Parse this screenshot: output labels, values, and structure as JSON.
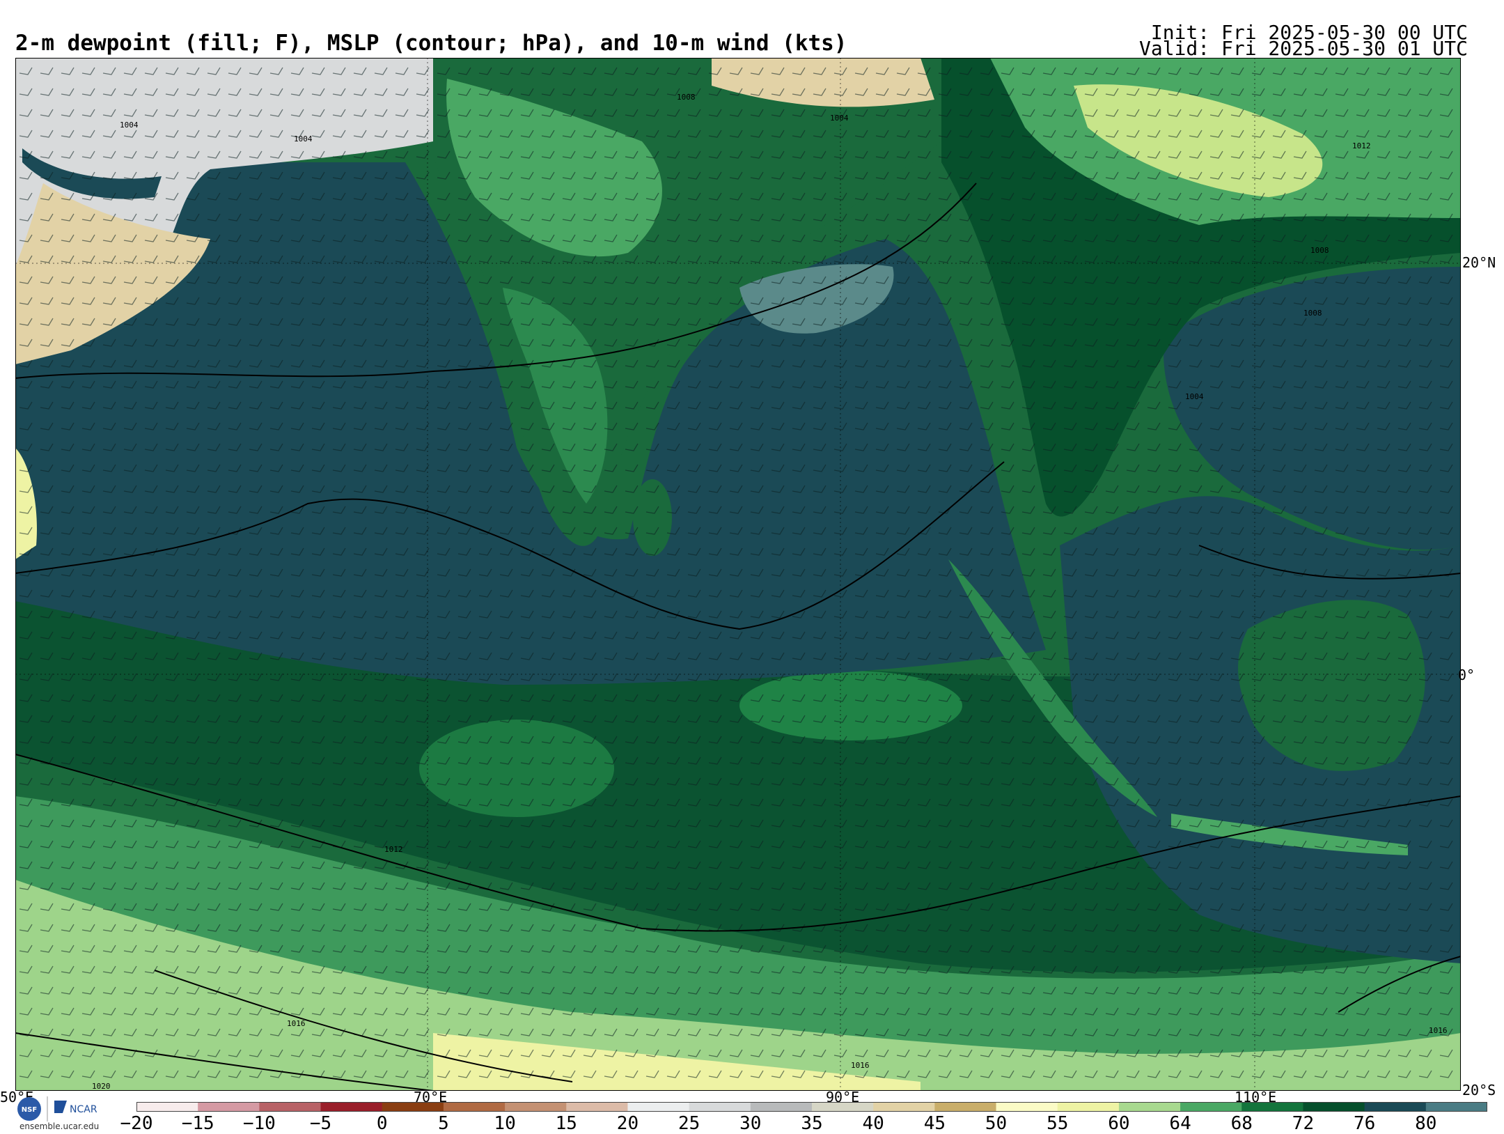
{
  "header": {
    "title": "2-m dewpoint (fill; F), MSLP (contour; hPa), and 10-m wind (kts)",
    "init": "Init: Fri 2025-05-30 00 UTC",
    "valid": "Valid: Fri 2025-05-30 01 UTC"
  },
  "map": {
    "lat_labels": [
      "20°N",
      "0°",
      "20°S"
    ],
    "lon_labels": [
      "50°E",
      "70°E",
      "90°E",
      "110°E"
    ],
    "isobar_labels": [
      "1008",
      "1004",
      "1004",
      "1004",
      "1008",
      "1012",
      "1008",
      "1004",
      "1012",
      "1016",
      "1016",
      "1016",
      "1020"
    ]
  },
  "colorbar": {
    "ticks": [
      "−20",
      "−15",
      "−10",
      "−5",
      "0",
      "5",
      "10",
      "15",
      "20",
      "25",
      "30",
      "35",
      "40",
      "45",
      "50",
      "55",
      "60",
      "64",
      "68",
      "72",
      "76",
      "80"
    ],
    "colors": [
      "#f7ecec",
      "#d59aa3",
      "#b86266",
      "#9a1f2a",
      "#8a3e12",
      "#b06a43",
      "#c49173",
      "#dcbba8",
      "#eceeef",
      "#d8dadb",
      "#b8babb",
      "#d6d6c6",
      "#e2d2a6",
      "#c9ae6a",
      "#fbfbc6",
      "#eef3a4",
      "#a8d98f",
      "#4aa864",
      "#13743c",
      "#06502c",
      "#1b4a56",
      "#4a7c84"
    ]
  },
  "logos": {
    "nsf": "NSF",
    "ncar": "NCAR",
    "url": "ensemble.ucar.edu"
  }
}
